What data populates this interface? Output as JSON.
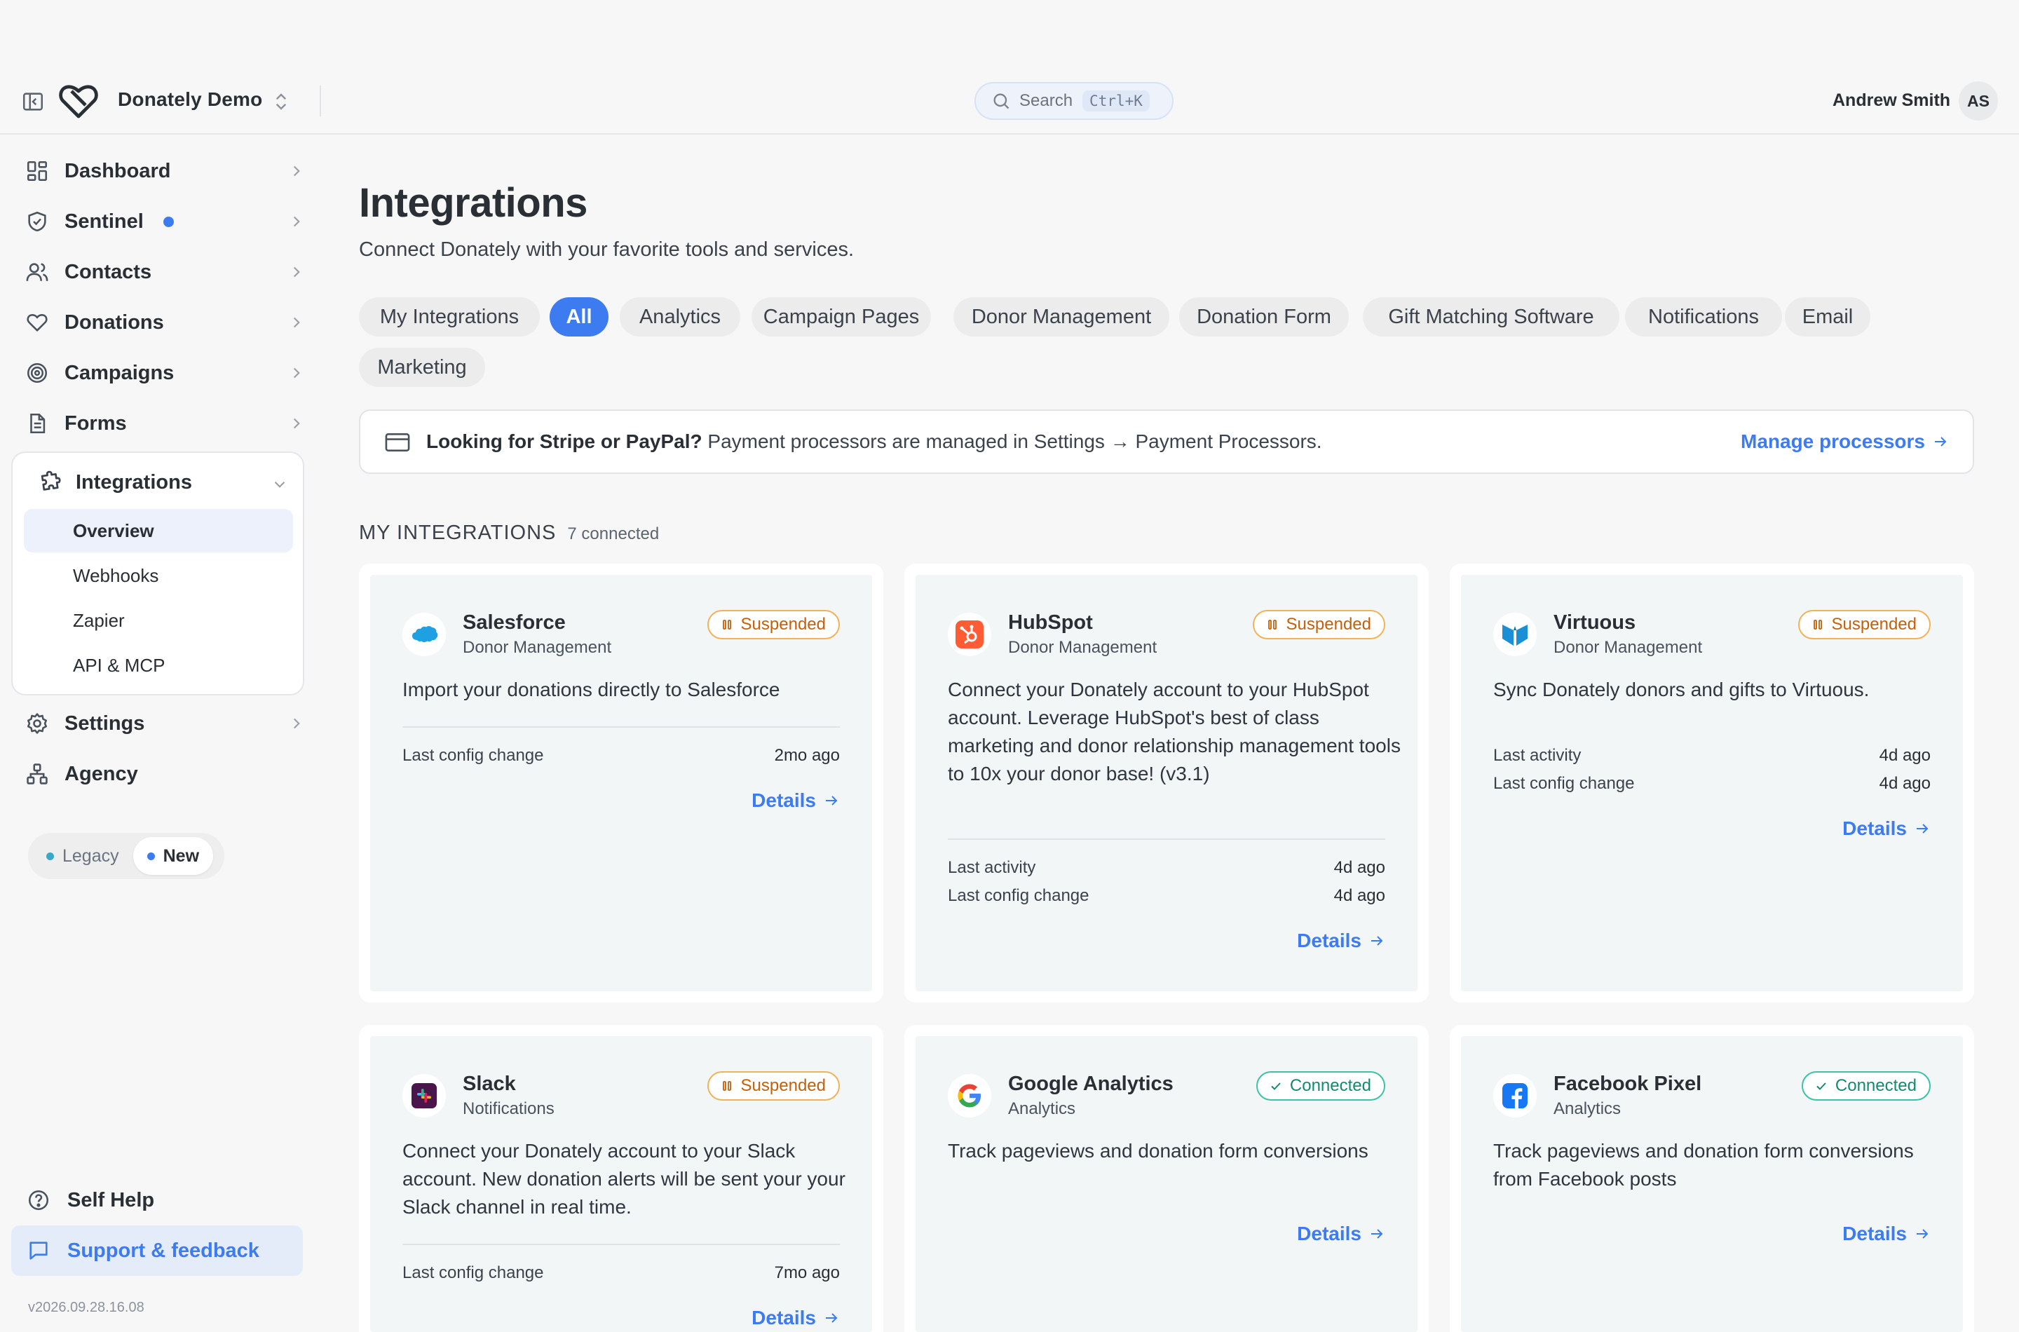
{
  "header": {
    "org_name": "Donately Demo",
    "search_label": "Search",
    "search_shortcut": "Ctrl+K",
    "user_name": "Andrew Smith",
    "user_initials": "AS"
  },
  "sidebar": {
    "items": [
      {
        "label": "Dashboard",
        "icon": "dashboard-icon"
      },
      {
        "label": "Sentinel",
        "icon": "shield-icon"
      },
      {
        "label": "Contacts",
        "icon": "users-icon"
      },
      {
        "label": "Donations",
        "icon": "heart-icon"
      },
      {
        "label": "Campaigns",
        "icon": "target-icon"
      },
      {
        "label": "Forms",
        "icon": "document-icon"
      }
    ],
    "integrations": {
      "label": "Integrations",
      "icon": "puzzle-icon",
      "sub_items": [
        "Overview",
        "Webhooks",
        "Zapier",
        "API & MCP"
      ],
      "active": "Overview"
    },
    "settings_label": "Settings",
    "agency_label": "Agency",
    "version_toggle": {
      "legacy": "Legacy",
      "new": "New",
      "selected": "New"
    },
    "self_help": "Self Help",
    "support": "Support & feedback",
    "version": "v2026.09.28.16.08"
  },
  "main": {
    "title": "Integrations",
    "subtitle": "Connect Donately with your favorite tools and services.",
    "filters": [
      "My Integrations",
      "All",
      "Analytics",
      "Campaign Pages",
      "Donor Management",
      "Donation Form",
      "Gift Matching Software",
      "Notifications",
      "Email",
      "Marketing"
    ],
    "active_filter": "All",
    "notice": {
      "bold": "Looking for Stripe or PayPal?",
      "text": " Payment processors are managed in Settings → Payment Processors.",
      "link": "Manage processors"
    },
    "section": {
      "title": "MY INTEGRATIONS",
      "count": "7 connected"
    },
    "cards": [
      {
        "name": "Salesforce",
        "category": "Donor Management",
        "status": "Suspended",
        "description": "Import your donations directly to Salesforce",
        "stats": [
          {
            "label": "Last config change",
            "value": "2mo ago"
          }
        ],
        "details": "Details"
      },
      {
        "name": "HubSpot",
        "category": "Donor Management",
        "status": "Suspended",
        "description": "Connect your Donately account to your HubSpot account. Leverage HubSpot's best of class marketing and donor relationship management tools to 10x your donor base! (v3.1)",
        "stats": [
          {
            "label": "Last activity",
            "value": "4d ago"
          },
          {
            "label": "Last config change",
            "value": "4d ago"
          }
        ],
        "details": "Details"
      },
      {
        "name": "Virtuous",
        "category": "Donor Management",
        "status": "Suspended",
        "description": "Sync Donately donors and gifts to Virtuous.",
        "stats": [
          {
            "label": "Last activity",
            "value": "4d ago"
          },
          {
            "label": "Last config change",
            "value": "4d ago"
          }
        ],
        "details": "Details"
      },
      {
        "name": "Slack",
        "category": "Notifications",
        "status": "Suspended",
        "description": "Connect your Donately account to your Slack account. New donation alerts will be sent your your Slack channel in real time.",
        "stats": [
          {
            "label": "Last config change",
            "value": "7mo ago"
          }
        ],
        "details": "Details"
      },
      {
        "name": "Google Analytics",
        "category": "Analytics",
        "status": "Connected",
        "description": "Track pageviews and donation form conversions",
        "stats": [],
        "details": "Details"
      },
      {
        "name": "Facebook Pixel",
        "category": "Analytics",
        "status": "Connected",
        "description": "Track pageviews and donation form conversions from Facebook posts",
        "stats": [],
        "details": "Details"
      }
    ]
  },
  "colors": {
    "accent": "#3d7bf0",
    "suspended": "#c2610c",
    "connected": "#148a71",
    "card_bg": "#f2f6f6"
  }
}
